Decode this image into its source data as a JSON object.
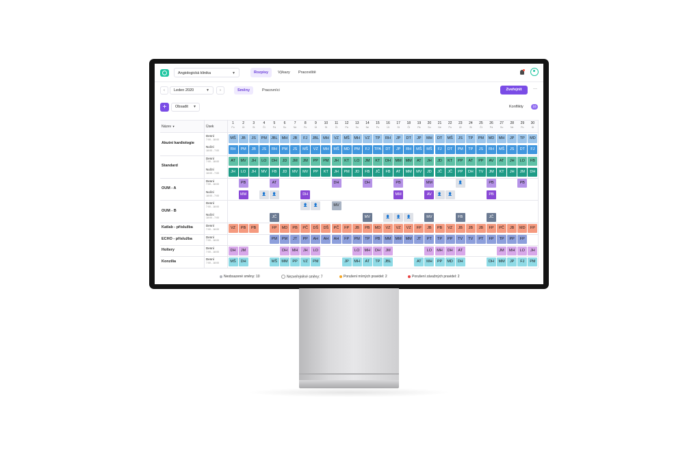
{
  "app": {
    "clinic": "Angiologická klinika",
    "nav": [
      "Rozpisy",
      "Výkazy",
      "Pracoviště"
    ],
    "active_nav": "Rozpisy"
  },
  "toolbar": {
    "month": "Leden 2020",
    "tabs": [
      "Směny",
      "Pracovníci"
    ],
    "publish": "Zveřejnit",
    "more": "···",
    "assign": "Obsadit",
    "conflicts_label": "Konflikty",
    "conflicts_count": "10"
  },
  "grid": {
    "col_name": "Název",
    "col_shift": "Úsek",
    "days": [
      {
        "n": "1",
        "w": "Po"
      },
      {
        "n": "2",
        "w": "Út"
      },
      {
        "n": "3",
        "w": "St"
      },
      {
        "n": "4",
        "w": "Čt"
      },
      {
        "n": "5",
        "w": "Pá"
      },
      {
        "n": "6",
        "w": "So"
      },
      {
        "n": "7",
        "w": "Ne"
      },
      {
        "n": "8",
        "w": "Po"
      },
      {
        "n": "9",
        "w": "Út"
      },
      {
        "n": "10",
        "w": "St"
      },
      {
        "n": "11",
        "w": "Čt"
      },
      {
        "n": "12",
        "w": "Pá"
      },
      {
        "n": "13",
        "w": "So"
      },
      {
        "n": "14",
        "w": "Ne"
      },
      {
        "n": "15",
        "w": "Po"
      },
      {
        "n": "16",
        "w": "Út"
      },
      {
        "n": "17",
        "w": "St"
      },
      {
        "n": "18",
        "w": "Čt"
      },
      {
        "n": "19",
        "w": "Pá"
      },
      {
        "n": "20",
        "w": "So"
      },
      {
        "n": "21",
        "w": "Ne"
      },
      {
        "n": "22",
        "w": "Po"
      },
      {
        "n": "23",
        "w": "Út"
      },
      {
        "n": "24",
        "w": "St"
      },
      {
        "n": "25",
        "w": "Čt"
      },
      {
        "n": "26",
        "w": "Pá"
      },
      {
        "n": "27",
        "w": "So"
      },
      {
        "n": "28",
        "w": "Ne"
      },
      {
        "n": "29",
        "w": "Po"
      },
      {
        "n": "30",
        "w": "Út"
      }
    ],
    "groups": [
      {
        "name": "Akutní kardiologie",
        "shifts": [
          {
            "label": "Denní",
            "hours": "7:00 - 18:00",
            "color": "#9cc6ec",
            "cells": [
              "MŠ",
              "JB",
              "JS",
              "PM",
              "JBL",
              "MH",
              "JB",
              "FJ",
              "JBL",
              "MH",
              "VZ",
              "MŠ",
              "MH",
              "VZ",
              "TP",
              "RH",
              "JP",
              "DT",
              "JP",
              "MH",
              "DT",
              "MŠ",
              "JS",
              "TP",
              "PM",
              "MD",
              "MH",
              "JP",
              "TP",
              "MD"
            ]
          },
          {
            "label": "Noční",
            "hours": "18:00 - 7:00",
            "color": "#3f96de",
            "cells": [
              "RH",
              "PM",
              "JB",
              "JS",
              "RH",
              "PM",
              "JS",
              "MŠ",
              "VZ",
              "MH",
              "MŠ",
              "MD",
              "PM",
              "FJ",
              "TPA",
              "DT",
              "JP",
              "RH",
              "MŠ",
              "MŠ",
              "FJ",
              "DT",
              "PM",
              "TP",
              "JS",
              "RH",
              "MŠ",
              "JS",
              "DT",
              "FJ"
            ]
          }
        ]
      },
      {
        "name": "Standard",
        "shifts": [
          {
            "label": "Denní",
            "hours": "7:00 - 18:00",
            "color": "#5fc1a6",
            "cells": [
              "AT",
              "MV",
              "JH",
              "LO",
              "DH",
              "JD",
              "JM",
              "JM",
              "PP",
              "PM",
              "JH",
              "KT",
              "LO",
              "JM",
              "KT",
              "DH",
              "MM",
              "MM",
              "AT",
              "JH",
              "JD",
              "KT",
              "PP",
              "AT",
              "PP",
              "AV",
              "AT",
              "JH",
              "LO",
              "FB"
            ]
          },
          {
            "label": "Noční",
            "hours": "18:00 - 7:00",
            "color": "#1e9b86",
            "cells": [
              "JH",
              "LO",
              "JH",
              "MV",
              "FB",
              "JD",
              "MV",
              "MV",
              "PP",
              "KT",
              "JH",
              "PM",
              "JD",
              "FB",
              "JČ",
              "FB",
              "AT",
              "MM",
              "MV",
              "JD",
              "JČ",
              "JČ",
              "PP",
              "DH",
              "TV",
              "JM",
              "KT",
              "JH",
              "JM",
              "DH"
            ]
          }
        ]
      },
      {
        "name": "OUM - A",
        "shifts": [
          {
            "label": "Denní",
            "hours": "7:00 - 18:00",
            "color": "#b693e8",
            "cells": [
              "",
              "PB",
              "",
              "",
              "AT",
              "",
              "",
              "",
              "",
              "",
              "DH",
              "",
              "",
              "DH",
              "",
              "",
              "PB",
              "",
              "",
              "MM",
              "",
              "",
              "U",
              "",
              "",
              "PB",
              "",
              "",
              "PB",
              ""
            ]
          },
          {
            "label": "Noční",
            "hours": "18:00 - 7:00",
            "color": "#8848d6",
            "cells": [
              "",
              "MM",
              "",
              "U",
              "U",
              "",
              "",
              "DH",
              "",
              "",
              "",
              "",
              "",
              "",
              "",
              "",
              "MM",
              "",
              "",
              "AV",
              "U",
              "U",
              "",
              "",
              "",
              "PB",
              "",
              "",
              "",
              ""
            ]
          }
        ]
      },
      {
        "name": "OUM - B",
        "shifts": [
          {
            "label": "Denní",
            "hours": "7:00 - 18:00",
            "color": "#a9b4c4",
            "cells": [
              "",
              "",
              "",
              "",
              "",
              "",
              "",
              "U",
              "U",
              "",
              "MV",
              "",
              "",
              "",
              "",
              "",
              "",
              "",
              "",
              "",
              "",
              "",
              "",
              "",
              "",
              "",
              "",
              "",
              "",
              ""
            ]
          },
          {
            "label": "Noční",
            "hours": "18:00 - 7:00",
            "color": "#6b7a92",
            "cells": [
              "",
              "",
              "",
              "",
              "JČ",
              "",
              "",
              "",
              "",
              "",
              "",
              "",
              "",
              "MV",
              "",
              "U",
              "U",
              "U",
              "",
              "MV",
              "",
              "",
              "FB",
              "",
              "",
              "JČ",
              "",
              "",
              "",
              ""
            ]
          }
        ]
      },
      {
        "name": "Katlab - příslužba",
        "shifts": [
          {
            "label": "Denní",
            "hours": "7:00 - 18:00",
            "color": "#f59a7f",
            "cells": [
              "VZ",
              "PB",
              "PB",
              "",
              "FP",
              "MD",
              "PB",
              "PČ",
              "DŠ",
              "DŠ",
              "PČ",
              "FP",
              "JB",
              "PB",
              "MD",
              "VZ",
              "VZ",
              "VZ",
              "FP",
              "JB",
              "PB",
              "VZ",
              "JB",
              "JB",
              "JB",
              "FP",
              "PČ",
              "JB",
              "MD",
              "FP"
            ]
          }
        ]
      },
      {
        "name": "ECHO - příslužba",
        "shifts": [
          {
            "label": "Denní",
            "hours": "7:00 - 18:00",
            "color": "#8d9fdc",
            "cells": [
              "",
              "",
              "",
              "",
              "PM",
              "PM",
              "JT",
              "PP",
              "AH",
              "AH",
              "AH",
              "FP",
              "PM",
              "TP",
              "PB",
              "MM",
              "MM",
              "MM",
              "JT",
              "PT",
              "TP",
              "PP",
              "TV",
              "TV",
              "PT",
              "FP",
              "TP",
              "PP",
              "FP",
              ""
            ]
          }
        ]
      },
      {
        "name": "Holtery",
        "shifts": [
          {
            "label": "Denní",
            "hours": "7:00 - 18:00",
            "color": "#d8a8ea",
            "cells": [
              "DH",
              "JM",
              "",
              "",
              "",
              "DH",
              "MH",
              "JH",
              "LO",
              "",
              "",
              "",
              "LO",
              "MH",
              "DH",
              "JM",
              "",
              "",
              "",
              "LO",
              "MH",
              "DH",
              "AT",
              "",
              "",
              "",
              "JM",
              "MH",
              "LO",
              "JH"
            ]
          }
        ]
      },
      {
        "name": "Konzília",
        "shifts": [
          {
            "label": "Denní",
            "hours": "7:00 - 18:00",
            "color": "#8fdbe6",
            "cells": [
              "MŠ",
              "DH",
              "",
              "",
              "MŠ",
              "MM",
              "PP",
              "VZ",
              "PM",
              "",
              "",
              "JP",
              "MH",
              "AT",
              "TP",
              "JBL",
              "",
              "",
              "AT",
              "MH",
              "PP",
              "MD",
              "DH",
              "",
              "",
              "DH",
              "MM",
              "JP",
              "FJ",
              "PM"
            ]
          }
        ]
      }
    ]
  },
  "legend": [
    {
      "label": "Neobsazené směny: 10",
      "color": "#b0b3ba"
    },
    {
      "label": "Nezveřejněné směny: 7",
      "color": "#ffffff"
    },
    {
      "label": "Porušení mírných pravidel: 2",
      "color": "#f5a623"
    },
    {
      "label": "Porušení závažných pravidel: 2",
      "color": "#e84040"
    }
  ],
  "icons": {
    "logo": "logo-icon",
    "bell": "bell-icon",
    "avatar": "user-avatar-icon",
    "unfilled": "person-placeholder-icon"
  }
}
